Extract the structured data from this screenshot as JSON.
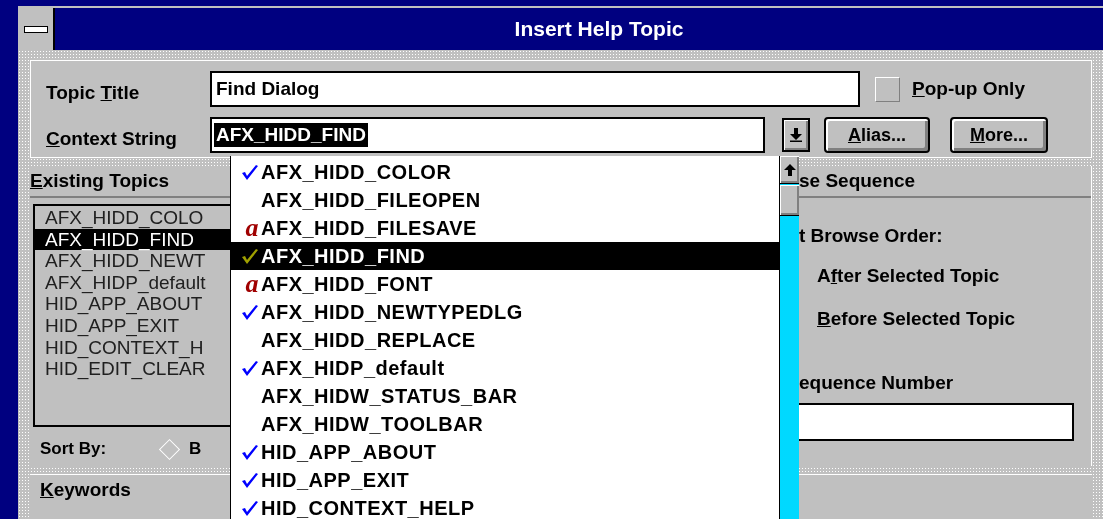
{
  "window": {
    "title": "Insert Help Topic"
  },
  "topic_title": {
    "label": {
      "pre": "Topic ",
      "key": "T",
      "post": "itle"
    },
    "value": "Find Dialog"
  },
  "popup_only": {
    "label": {
      "key": "P",
      "post": "op-up Only"
    },
    "checked": false
  },
  "context_string": {
    "label": {
      "key": "C",
      "post": "ontext String"
    },
    "value": "AFX_HIDD_FIND",
    "highlighted": true
  },
  "buttons": [
    {
      "label": {
        "key": "A",
        "post": "lias..."
      }
    },
    {
      "label": {
        "key": "M",
        "post": "ore..."
      }
    }
  ],
  "existing_topics": {
    "header": {
      "key": "E",
      "post": "xisting Topics"
    },
    "items": [
      {
        "text": "AFX_HIDD_COLO",
        "selected": false
      },
      {
        "text": "AFX_HIDD_FIND",
        "selected": true
      },
      {
        "text": "AFX_HIDD_NEWT",
        "selected": false
      },
      {
        "text": "AFX_HIDP_default",
        "selected": false
      },
      {
        "text": "HID_APP_ABOUT",
        "selected": false
      },
      {
        "text": "HID_APP_EXIT",
        "selected": false
      },
      {
        "text": "HID_CONTEXT_H",
        "selected": false
      },
      {
        "text": "HID_EDIT_CLEAR",
        "selected": false
      }
    ],
    "sort_by": {
      "label": "Sort By:",
      "option": {
        "label": "B",
        "checked": false
      }
    }
  },
  "browse_sequence": {
    "header": "se Sequence",
    "order_label": "t Browse Order:",
    "options": [
      {
        "label": {
          "pre": "A",
          "key": "f",
          "post": "ter Selected Topic"
        }
      },
      {
        "label": {
          "key": "B",
          "post": "efore Selected Topic"
        }
      }
    ],
    "number_label": "equence Number"
  },
  "keywords": {
    "label": {
      "key": "K",
      "post": "eywords"
    }
  },
  "dropdown": {
    "items": [
      {
        "kind": "check",
        "text": "AFX_HIDD_COLOR",
        "selected": false
      },
      {
        "kind": "none",
        "text": "AFX_HIDD_FILEOPEN",
        "selected": false
      },
      {
        "kind": "alias",
        "mark": "a",
        "text": "AFX_HIDD_FILESAVE",
        "selected": false
      },
      {
        "kind": "check",
        "text": "AFX_HIDD_FIND",
        "selected": true
      },
      {
        "kind": "alias",
        "mark": "a",
        "text": "AFX_HIDD_FONT",
        "selected": false
      },
      {
        "kind": "check",
        "text": "AFX_HIDD_NEWTYPEDLG",
        "selected": false
      },
      {
        "kind": "none",
        "text": "AFX_HIDD_REPLACE",
        "selected": false
      },
      {
        "kind": "check",
        "text": "AFX_HIDP_default",
        "selected": false
      },
      {
        "kind": "none",
        "text": "AFX_HIDW_STATUS_BAR",
        "selected": false
      },
      {
        "kind": "none",
        "text": "AFX_HIDW_TOOLBAR",
        "selected": false
      },
      {
        "kind": "check",
        "text": "HID_APP_ABOUT",
        "selected": false
      },
      {
        "kind": "check",
        "text": "HID_APP_EXIT",
        "selected": false
      },
      {
        "kind": "check",
        "text": "HID_CONTEXT_HELP",
        "selected": false
      }
    ]
  }
}
